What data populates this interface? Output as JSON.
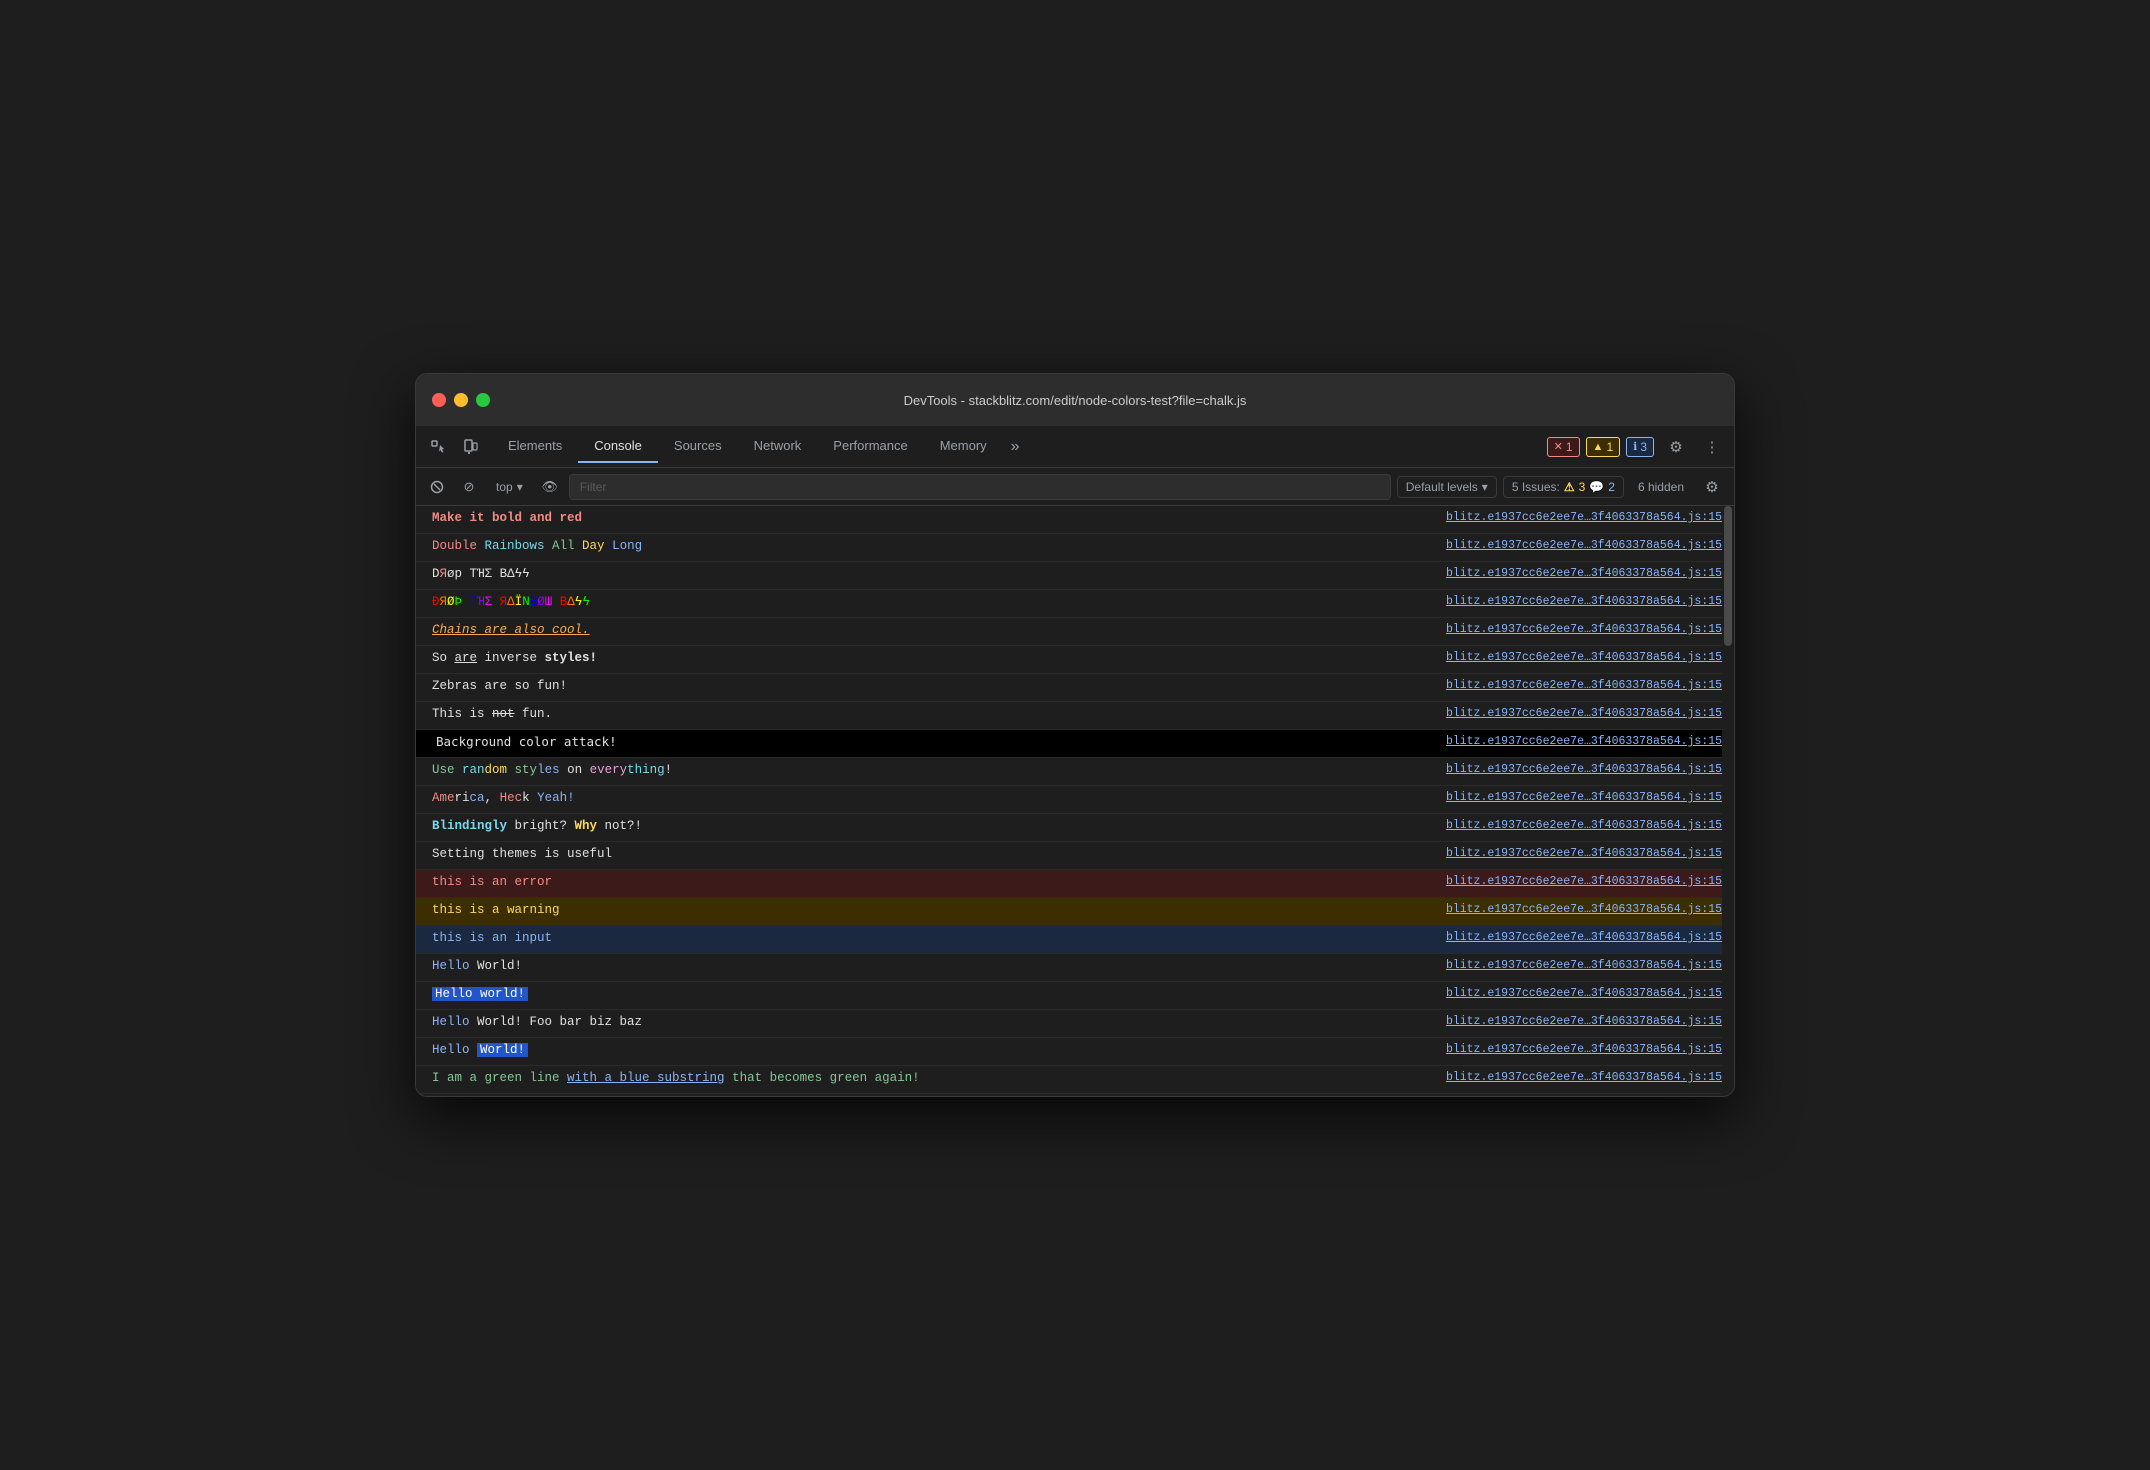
{
  "window": {
    "title": "DevTools - stackblitz.com/edit/node-colors-test?file=chalk.js"
  },
  "tabs": {
    "items": [
      "Elements",
      "Console",
      "Sources",
      "Network",
      "Performance",
      "Memory"
    ],
    "active": "Console",
    "more_label": "»"
  },
  "badges": {
    "error": {
      "icon": "✕",
      "count": "1"
    },
    "warning": {
      "icon": "▲",
      "count": "1"
    },
    "info": {
      "icon": "!",
      "count": "3"
    }
  },
  "toolbar": {
    "filter_placeholder": "Filter",
    "context_label": "top",
    "levels_label": "Default levels",
    "issues_label": "5 Issues:",
    "issues_warn": "3",
    "issues_info": "2",
    "hidden_label": "6 hidden"
  },
  "source": "blitz.e1937cc6e2ee7e…3f4063378a564.js:15",
  "log_rows": [
    {
      "id": 1,
      "type": "normal"
    },
    {
      "id": 2,
      "type": "normal"
    },
    {
      "id": 3,
      "type": "normal"
    },
    {
      "id": 4,
      "type": "normal"
    },
    {
      "id": 5,
      "type": "normal"
    },
    {
      "id": 6,
      "type": "normal"
    },
    {
      "id": 7,
      "type": "normal"
    },
    {
      "id": 8,
      "type": "normal"
    },
    {
      "id": 9,
      "type": "normal"
    },
    {
      "id": 10,
      "type": "normal"
    },
    {
      "id": 11,
      "type": "normal"
    },
    {
      "id": 12,
      "type": "normal"
    },
    {
      "id": 13,
      "type": "error"
    },
    {
      "id": 14,
      "type": "warn"
    },
    {
      "id": 15,
      "type": "info"
    },
    {
      "id": 16,
      "type": "normal"
    },
    {
      "id": 17,
      "type": "normal"
    },
    {
      "id": 18,
      "type": "normal"
    },
    {
      "id": 19,
      "type": "normal"
    },
    {
      "id": 20,
      "type": "normal"
    },
    {
      "id": 21,
      "type": "normal"
    }
  ]
}
